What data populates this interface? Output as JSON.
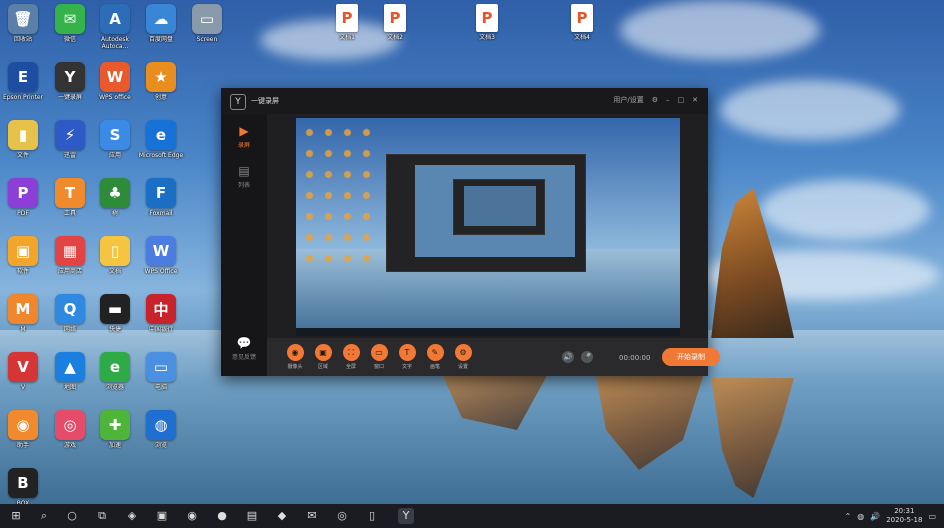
{
  "desktop": {
    "icons_left": [
      {
        "label": "回收站",
        "icon": "recycle-bin-icon",
        "color": "#5a7fa8",
        "glyph": "🗑"
      },
      {
        "label": "微信",
        "icon": "wechat-icon",
        "color": "#33b34a",
        "glyph": "✉"
      },
      {
        "label": "Autodesk Autoca...",
        "icon": "autodesk-icon",
        "color": "#2d6cb7",
        "glyph": "A"
      },
      {
        "label": "百度网盘",
        "icon": "cloud-disk-icon",
        "color": "#3a86d6",
        "glyph": "☁"
      },
      {
        "label": "Screen",
        "icon": "screen-icon",
        "color": "#8899aa",
        "glyph": "▭"
      },
      {
        "label": "Epson Printer",
        "icon": "epson-icon",
        "color": "#1d4ea0",
        "glyph": "E"
      },
      {
        "label": "一键录屏",
        "icon": "recorder-icon",
        "color": "#333333",
        "glyph": "Y"
      },
      {
        "label": "WPS office",
        "icon": "wps-icon",
        "color": "#e8592b",
        "glyph": "W"
      },
      {
        "label": "创意",
        "icon": "creative-icon",
        "color": "#e98e1e",
        "glyph": "★"
      },
      {
        "label": "文件",
        "icon": "folder-icon",
        "color": "#e6c24a",
        "glyph": "▮"
      },
      {
        "label": "迅雷",
        "icon": "thunder-icon",
        "color": "#2e5ac8",
        "glyph": "⚡"
      },
      {
        "label": "应用",
        "icon": "app-icon",
        "color": "#3a8ae6",
        "glyph": "S"
      },
      {
        "label": "Microsoft Edge",
        "icon": "edge-icon",
        "color": "#1672d6",
        "glyph": "e"
      },
      {
        "label": "PDF",
        "icon": "pdf-icon",
        "color": "#8b3fd6",
        "glyph": "P"
      },
      {
        "label": "工具",
        "icon": "tool-icon",
        "color": "#f08a2c",
        "glyph": "T"
      },
      {
        "label": "树",
        "icon": "tree-icon",
        "color": "#2e8b3a",
        "glyph": "♣"
      },
      {
        "label": "Foxmail",
        "icon": "foxmail-icon",
        "color": "#1a6fc4",
        "glyph": "F"
      },
      {
        "label": "软件",
        "icon": "software-icon",
        "color": "#f3a52b",
        "glyph": "▣"
      },
      {
        "label": "应用商店",
        "icon": "store-icon",
        "color": "#e24343",
        "glyph": "▦"
      },
      {
        "label": "文档",
        "icon": "doc-icon",
        "color": "#f5c542",
        "glyph": "▯"
      },
      {
        "label": "WPS Office",
        "icon": "wps-office-icon",
        "color": "#4b7de0",
        "glyph": "W"
      },
      {
        "label": "M",
        "icon": "m-app-icon",
        "color": "#f0872c",
        "glyph": "M"
      },
      {
        "label": "网络",
        "icon": "network-icon",
        "color": "#2f89e0",
        "glyph": "Q"
      },
      {
        "label": "快捷",
        "icon": "shortcut-icon",
        "color": "#222222",
        "glyph": "▬"
      },
      {
        "label": "中国银行",
        "icon": "bank-icon",
        "color": "#c8232b",
        "glyph": "中"
      },
      {
        "label": "V",
        "icon": "v-app-icon",
        "color": "#d63535",
        "glyph": "V"
      },
      {
        "label": "地图",
        "icon": "map-icon",
        "color": "#1b7fe0",
        "glyph": "▲"
      },
      {
        "label": "浏览器",
        "icon": "browser-icon",
        "color": "#2eaa46",
        "glyph": "e"
      },
      {
        "label": "电脑",
        "icon": "computer-icon",
        "color": "#4a8fe0",
        "glyph": "▭"
      },
      {
        "label": "助手",
        "icon": "assistant-icon",
        "color": "#f08a2c",
        "glyph": "◉"
      },
      {
        "label": "游戏",
        "icon": "game-icon",
        "color": "#e44c6a",
        "glyph": "◎"
      },
      {
        "label": "加速",
        "icon": "accelerate-icon",
        "color": "#4eb53a",
        "glyph": "✚"
      },
      {
        "label": "浏览",
        "icon": "globe-icon",
        "color": "#1f6fd0",
        "glyph": "◍"
      },
      {
        "label": "BOX",
        "icon": "box-icon",
        "color": "#222222",
        "glyph": "B"
      }
    ],
    "icons_top": [
      {
        "label": "文档1",
        "icon": "ppt-file-icon",
        "color": "#e2572b",
        "glyph": "P"
      },
      {
        "label": "文档2",
        "icon": "ppt-file-icon",
        "color": "#e2572b",
        "glyph": "P"
      },
      {
        "label": "文档3",
        "icon": "ppt-file-icon",
        "color": "#e2572b",
        "glyph": "P"
      },
      {
        "label": "文档4",
        "icon": "ppt-file-icon",
        "color": "#e2572b",
        "glyph": "P"
      }
    ]
  },
  "app": {
    "title": "一键录屏",
    "logo": "Y",
    "title_right": {
      "menu": "用户/设置",
      "gear": "⚙"
    },
    "sidebar": [
      {
        "label": "录屏",
        "glyph": "▶",
        "active": true
      },
      {
        "label": "列表",
        "glyph": "▤",
        "active": false
      },
      {
        "label": "意见反馈",
        "glyph": "💬",
        "active": false
      }
    ],
    "tools": [
      {
        "label": "摄像头",
        "glyph": "◉"
      },
      {
        "label": "区域",
        "glyph": "▣"
      },
      {
        "label": "全屏",
        "glyph": "⛶"
      },
      {
        "label": "窗口",
        "glyph": "▭"
      },
      {
        "label": "文字",
        "glyph": "T"
      },
      {
        "label": "画笔",
        "glyph": "✎"
      },
      {
        "label": "设置",
        "glyph": "⚙"
      }
    ],
    "volume_glyph": "🔊",
    "mic_glyph": "🎤",
    "timer": "00:00:00",
    "start_label": "开始录制"
  },
  "taskbar": {
    "apps": [
      {
        "glyph": "⊞",
        "icon": "start-icon"
      },
      {
        "glyph": "⌕",
        "icon": "search-icon"
      },
      {
        "glyph": "○",
        "icon": "cortana-icon"
      },
      {
        "glyph": "⧉",
        "icon": "task-view-icon"
      },
      {
        "glyph": "◈",
        "icon": "edge-icon"
      },
      {
        "glyph": "▣",
        "icon": "store-icon"
      },
      {
        "glyph": "◉",
        "icon": "app-icon"
      },
      {
        "glyph": "●",
        "icon": "recorder-icon"
      },
      {
        "glyph": "▤",
        "icon": "files-icon"
      },
      {
        "glyph": "◆",
        "icon": "browser-icon"
      },
      {
        "glyph": "✉",
        "icon": "wechat-icon"
      },
      {
        "glyph": "◎",
        "icon": "chrome-icon"
      },
      {
        "glyph": "▯",
        "icon": "folder-icon"
      },
      {
        "glyph": "Y",
        "icon": "recorder-app-icon"
      }
    ],
    "time": "20:31",
    "date": "2020-5-18"
  }
}
